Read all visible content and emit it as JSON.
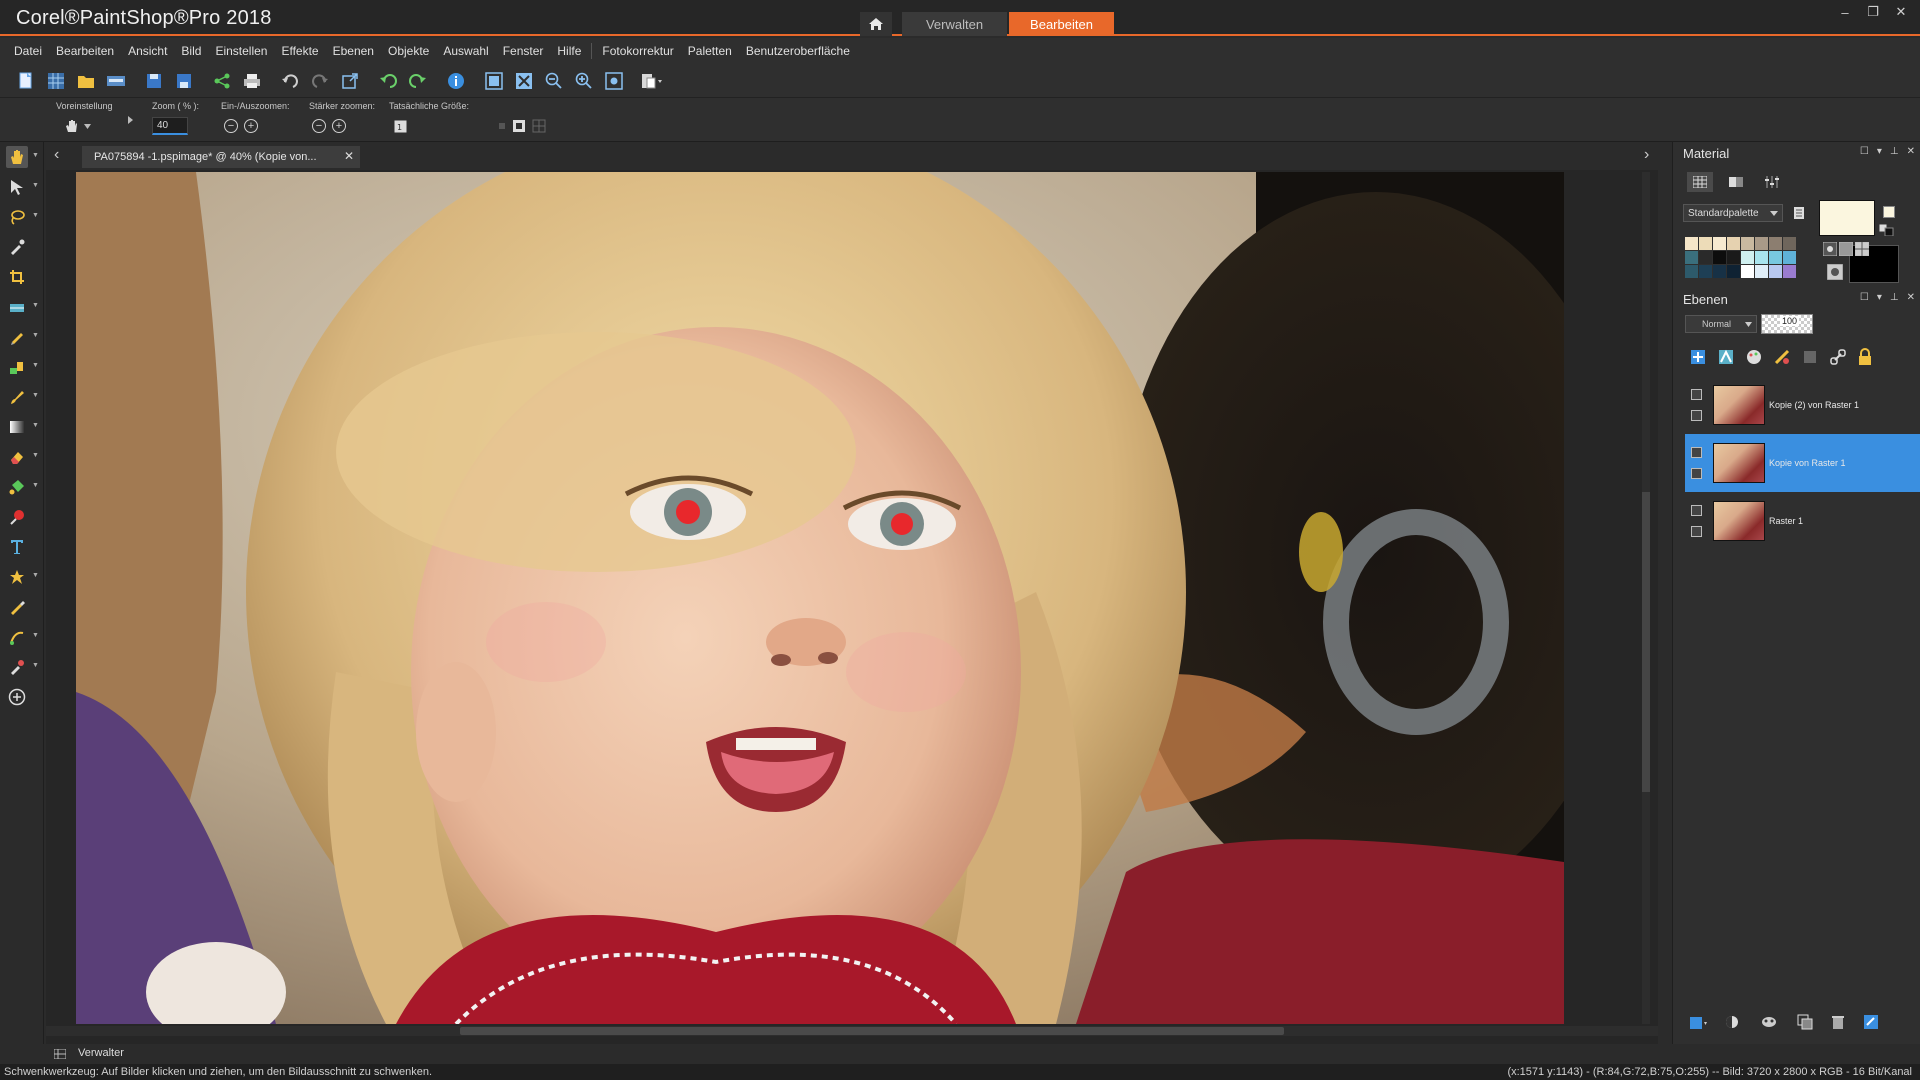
{
  "app": {
    "title": "Corel®PaintShop®Pro 2018",
    "mode_tabs": [
      {
        "label": "Verwalten",
        "active": false
      },
      {
        "label": "Bearbeiten",
        "active": true
      }
    ],
    "accent_color": "#e8682a",
    "window_controls": {
      "minimize": "–",
      "restore": "❐",
      "close": "✕"
    }
  },
  "menu": {
    "items": [
      "Datei",
      "Bearbeiten",
      "Ansicht",
      "Bild",
      "Einstellen",
      "Effekte",
      "Ebenen",
      "Objekte",
      "Auswahl",
      "Fenster",
      "Hilfe"
    ],
    "extra_items": [
      "Fotokorrektur",
      "Paletten",
      "Benutzeroberfläche"
    ]
  },
  "tool_options": {
    "preset_label": "Voreinstellung",
    "zoom_label": "Zoom ( % ):",
    "zoom_value": "40",
    "zoom_inout_label": "Ein-/Auszoomen:",
    "zoom_more_label": "Stärker zoomen:",
    "actual_size_label": "Tatsächliche Größe:"
  },
  "document": {
    "tab_title": "PA075894 -1.pspimage*  @  40% (Kopie von..."
  },
  "material_panel": {
    "title": "Material",
    "palette_select": "Standardpalette",
    "foreground_color": "#fbf6df",
    "background_color": "#000000",
    "swatches": [
      "#f5e6c8",
      "#eddcb8",
      "#f7ead0",
      "#e6d2b0",
      "#c9b9a0",
      "#a99a88",
      "#8c7e70",
      "#6f665c",
      "#3a6f7d",
      "#2a2a2a",
      "#0d0d0d",
      "#1a1a1a",
      "#d0f0f0",
      "#a8e4ee",
      "#78c8e0",
      "#5fb2d8",
      "#2d5a6b",
      "#1e3f55",
      "#173146",
      "#0f2233",
      "#ffffff",
      "#e0eef8",
      "#b8c8f0",
      "#9a7cd0"
    ]
  },
  "layers_panel": {
    "title": "Ebenen",
    "blend_mode": "Normal",
    "opacity": "100",
    "selected_color": "#3a8fe0",
    "layers": [
      {
        "name": "Kopie (2) von Raster 1",
        "selected": false
      },
      {
        "name": "Kopie von Raster 1",
        "selected": true
      },
      {
        "name": "Raster 1",
        "selected": false
      }
    ]
  },
  "bottom": {
    "organizer_label": "Verwalter"
  },
  "status": {
    "hint": "Schwenkwerkzeug: Auf Bilder klicken und ziehen, um den Bildausschnitt zu schwenken.",
    "info": "(x:1571 y:1143) - (R:84,G:72,B:75,O:255) -- Bild:  3720 x 2800 x RGB - 16 Bit/Kanal"
  },
  "icons": {
    "toolbar": [
      "new-file-icon",
      "browse-icon",
      "open-folder-icon",
      "scan-icon",
      "save-icon",
      "save-as-icon",
      "share-icon",
      "print-icon",
      "undo-icon",
      "redo-icon",
      "resize-icon",
      "undo-history-icon",
      "redo-history-icon",
      "info-icon",
      "fit-window-icon",
      "fit-image-icon",
      "zoom-out-icon",
      "zoom-in-icon",
      "actual-size-icon",
      "paste-icon"
    ],
    "tools": [
      "pan-tool-icon",
      "pick-tool-icon",
      "lasso-tool-icon",
      "dropper-tool-icon",
      "crop-tool-icon",
      "straighten-tool-icon",
      "clone-tool-icon",
      "object-remover-icon",
      "paint-brush-icon",
      "gradient-icon",
      "eraser-icon",
      "fill-icon",
      "red-eye-icon",
      "text-tool-icon",
      "preset-shape-icon",
      "pen-tool-icon",
      "retouch-icon",
      "color-changer-icon",
      "add-tool-icon"
    ]
  }
}
